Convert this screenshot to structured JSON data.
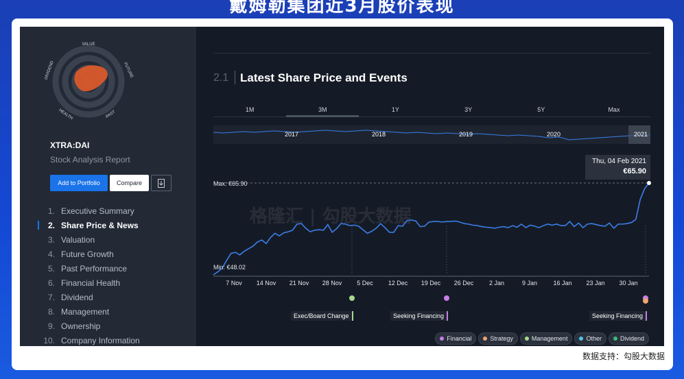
{
  "page_title": "戴姆勒集团近3月股价表现",
  "footer_note": "数据支持：勾股大数据",
  "watermark": "格隆汇 | 勾股大数据",
  "sidebar": {
    "snowflake": {
      "labels": [
        "VALUE",
        "FUTURE",
        "PAST",
        "HEALTH",
        "DIVIDEND"
      ],
      "fill_color": "#d95a2b"
    },
    "ticker": "XTRA:DAI",
    "report_label": "Stock Analysis Report",
    "buttons": {
      "add_to_portfolio": "Add to Portfolio",
      "compare": "Compare",
      "download_icon": "download-icon"
    },
    "nav": [
      {
        "num": "1.",
        "label": "Executive Summary"
      },
      {
        "num": "2.",
        "label": "Share Price & News",
        "active": true
      },
      {
        "num": "3.",
        "label": "Valuation"
      },
      {
        "num": "4.",
        "label": "Future Growth"
      },
      {
        "num": "5.",
        "label": "Past Performance"
      },
      {
        "num": "6.",
        "label": "Financial Health"
      },
      {
        "num": "7.",
        "label": "Dividend"
      },
      {
        "num": "8.",
        "label": "Management"
      },
      {
        "num": "9.",
        "label": "Ownership"
      },
      {
        "num": "10.",
        "label": "Company Information"
      }
    ]
  },
  "main": {
    "section_num": "2.1",
    "section_title": "Latest Share Price and Events",
    "tabs": [
      "1M",
      "3M",
      "1Y",
      "3Y",
      "5Y",
      "Max"
    ],
    "active_tab": "3M",
    "mini_years": [
      "2017",
      "2018",
      "2019",
      "2020",
      "2021"
    ],
    "tooltip": {
      "date": "Thu, 04 Feb 2021",
      "value": "€65.90"
    },
    "events": [
      {
        "label": "Exec/Board Change",
        "color": "#a7d98c"
      },
      {
        "label": "Seeking Financing",
        "color": "#c77ee8"
      },
      {
        "label": "Seeking Financing",
        "color": "#c77ee8"
      }
    ],
    "legend": [
      {
        "label": "Financial",
        "color": "#c77ee8"
      },
      {
        "label": "Strategy",
        "color": "#f0a472"
      },
      {
        "label": "Management",
        "color": "#a7d98c"
      },
      {
        "label": "Other",
        "color": "#4fc3e8"
      },
      {
        "label": "Dividend",
        "color": "#3fb97a"
      }
    ]
  },
  "chart_data": {
    "type": "line",
    "x_tick_labels": [
      "7 Nov",
      "14 Nov",
      "21 Nov",
      "28 Nov",
      "5 Dec",
      "12 Dec",
      "19 Dec",
      "26 Dec",
      "2 Jan",
      "9 Jan",
      "16 Jan",
      "23 Jan",
      "30 Jan"
    ],
    "max_label": "Max: €65.90",
    "min_label": "Min: €48.02",
    "ylim": [
      48.02,
      65.9
    ],
    "line_color": "#3a7ee8",
    "series": [
      {
        "values": [
          48.02,
          48.6,
          49.3,
          50.8,
          52.2,
          52.4,
          51.9,
          52.6,
          53.1,
          53.6,
          54.4,
          54.8,
          54.1,
          55.3,
          56.1,
          55.6,
          56.2,
          56.4,
          56.7,
          57.9,
          58.0,
          57.1,
          56.4,
          56.7,
          56.8,
          56.7,
          57.8,
          56.3,
          57.0,
          58.0,
          57.9,
          57.6,
          57.7,
          57.5,
          56.8,
          56.1,
          56.5,
          57.1,
          58.0,
          57.2,
          56.3,
          56.3,
          57.6,
          57.5,
          58.6,
          58.7,
          58.5,
          57.4,
          57.5,
          58.3,
          58.4,
          58.4,
          58.3,
          58.4,
          58.4,
          58.5,
          58.3,
          58.0,
          57.9,
          57.7,
          57.6,
          57.4,
          57.3,
          57.2,
          57.1,
          57.3,
          57.4,
          57.2,
          57.6,
          57.3,
          57.9,
          57.2,
          57.7,
          57.5,
          57.2,
          57.6,
          57.9,
          57.7,
          57.9,
          57.6,
          57.6,
          58.4,
          57.4,
          58.1,
          57.2,
          57.9,
          58.0,
          57.8,
          57.6,
          57.5,
          58.1,
          57.1,
          57.9,
          57.9,
          58.0,
          58.2,
          58.8,
          62.7,
          64.8,
          65.9
        ]
      }
    ]
  }
}
